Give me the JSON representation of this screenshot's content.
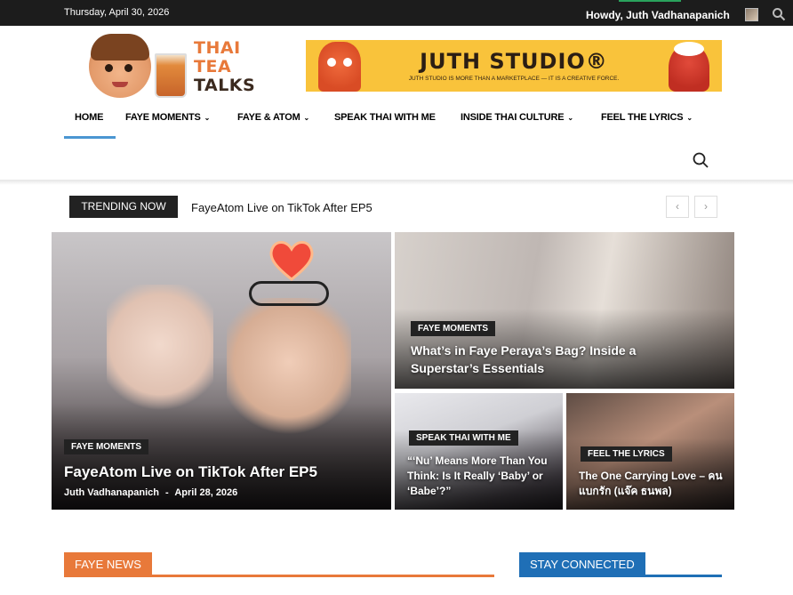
{
  "topbar": {
    "date": "Thursday, April 30, 2026",
    "howdy": "Howdy, Juth Vadhanapanich",
    "icons": [
      "tiktok-icon",
      "x-icon",
      "globe-icon"
    ]
  },
  "logo": {
    "line1": "THAI",
    "line2": "TEA",
    "line3": "TALKS"
  },
  "banner": {
    "title": "JUTH STUDIO®",
    "subtitle": "JUTH STUDIO IS MORE THAN A MARKETPLACE — IT IS A CREATIVE FORCE."
  },
  "nav": {
    "items": [
      {
        "label": "HOME",
        "dropdown": false,
        "active": true
      },
      {
        "label": "FAYE MOMENTS",
        "dropdown": true
      },
      {
        "label": "FAYE & ATOM",
        "dropdown": true
      },
      {
        "label": "SPEAK THAI WITH ME",
        "dropdown": false
      },
      {
        "label": "INSIDE THAI CULTURE",
        "dropdown": true
      },
      {
        "label": "FEEL THE LYRICS",
        "dropdown": true
      }
    ],
    "chevron": "⌄"
  },
  "trending": {
    "label": "TRENDING NOW",
    "headline": "FayeAtom Live on TikTok After EP5",
    "prev": "‹",
    "next": "›"
  },
  "featured": {
    "main": {
      "category": "FAYE MOMENTS",
      "title": "FayeAtom Live on TikTok After EP5",
      "author": "Juth Vadhanapanich",
      "sep": "-",
      "date": "April 28, 2026"
    },
    "top_right": {
      "category": "FAYE MOMENTS",
      "title": "What’s in Faye Peraya’s Bag? Inside a Superstar’s Essentials"
    },
    "bottom_left": {
      "category": "SPEAK THAI WITH ME",
      "title": "“‘Nu’ Means More Than You Think: Is It Really ‘Baby’ or ‘Babe’?”"
    },
    "bottom_right": {
      "category": "FEEL THE LYRICS",
      "title": "The One Carrying Love – คนแบกรัก (แจ๊ค ธนพล)"
    }
  },
  "sections": {
    "left": {
      "label": "FAYE NEWS",
      "color": "#e8793a"
    },
    "right": {
      "label": "STAY CONNECTED",
      "color": "#1f6fb6"
    }
  },
  "colors": {
    "accent": "#4b96d2",
    "brand_orange": "#e8793a",
    "topbar": "#1c1c1c"
  }
}
